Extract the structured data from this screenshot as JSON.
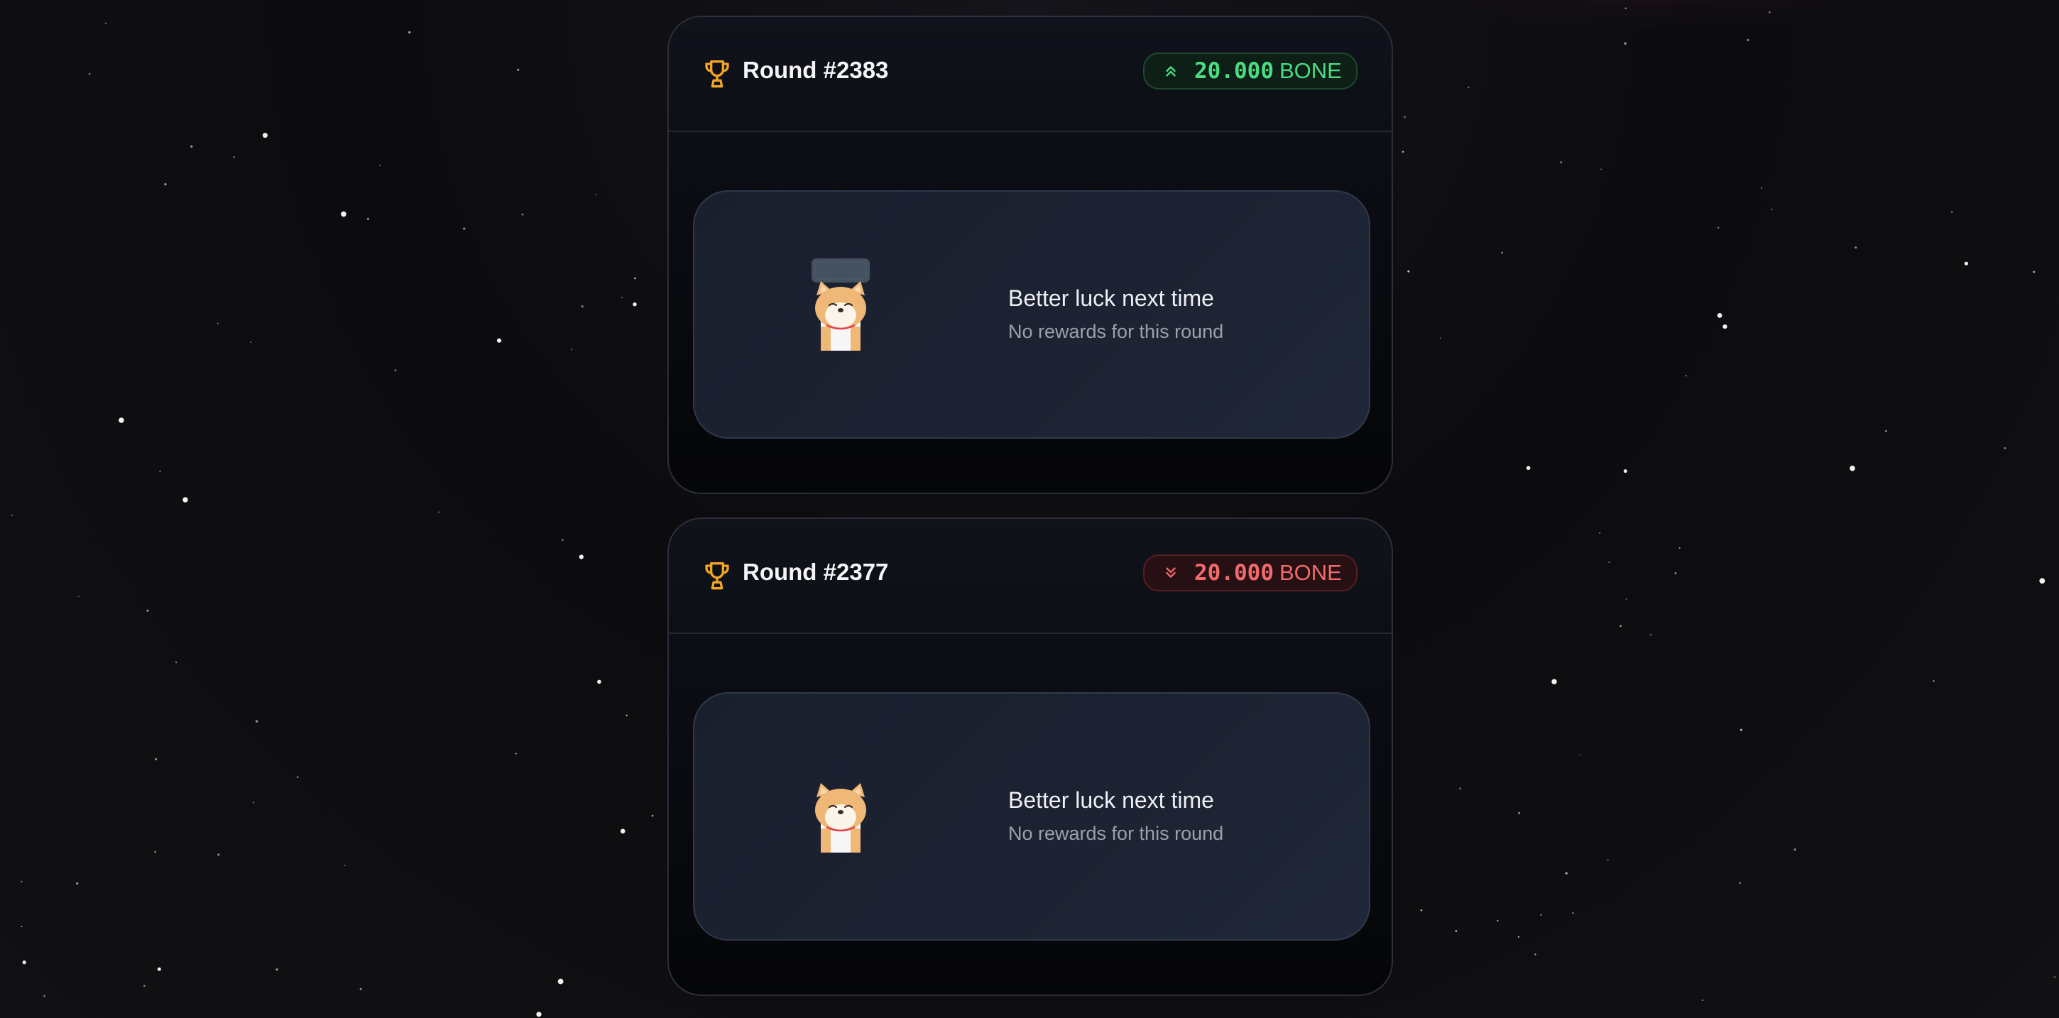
{
  "theme": {
    "trophy_color": "#f5a524",
    "win_color": "#4ade80",
    "loss_color": "#f26b6b"
  },
  "rounds": [
    {
      "title": "Round #2383",
      "result": "up",
      "icon": "chevrons-up-icon",
      "amount": "20.000",
      "token": "BONE",
      "message_title": "Better luck next time",
      "message_subtitle": "No rewards for this round",
      "mascot": "shiba-mascot-with-lid-icon"
    },
    {
      "title": "Round #2377",
      "result": "down",
      "icon": "chevrons-down-icon",
      "amount": "20.000",
      "token": "BONE",
      "message_title": "Better luck next time",
      "message_subtitle": "No rewards for this round",
      "mascot": "shiba-mascot-icon"
    }
  ]
}
